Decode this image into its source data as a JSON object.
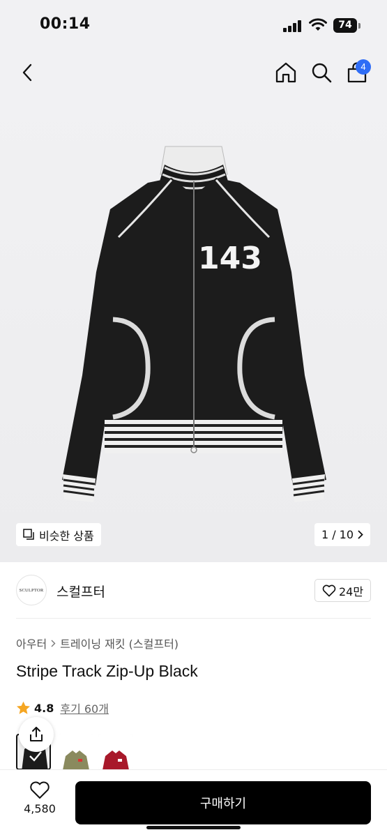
{
  "status": {
    "time": "00:14",
    "battery": "74"
  },
  "nav": {
    "cart_count": "4",
    "icons": [
      "back-icon",
      "home-icon",
      "search-icon",
      "bag-icon"
    ]
  },
  "hero": {
    "similar_label": "비슷한 상품",
    "pager": "1 / 10",
    "jacket_patch": "143"
  },
  "brand": {
    "logo_text": "SCULPTOR",
    "name": "스컬프터",
    "likes": "24만"
  },
  "breadcrumb": {
    "category": "아우터",
    "subcategory": "트레이닝 재킷 (스컬프터)"
  },
  "product": {
    "title": "Stripe Track Zip-Up Black",
    "rating": "4.8",
    "reviews": "후기 60개"
  },
  "bottom": {
    "like_count": "4,580",
    "buy_label": "구매하기"
  },
  "colors": {
    "accent": "#2f6df6",
    "star": "#f5a623",
    "button": "#000000"
  }
}
